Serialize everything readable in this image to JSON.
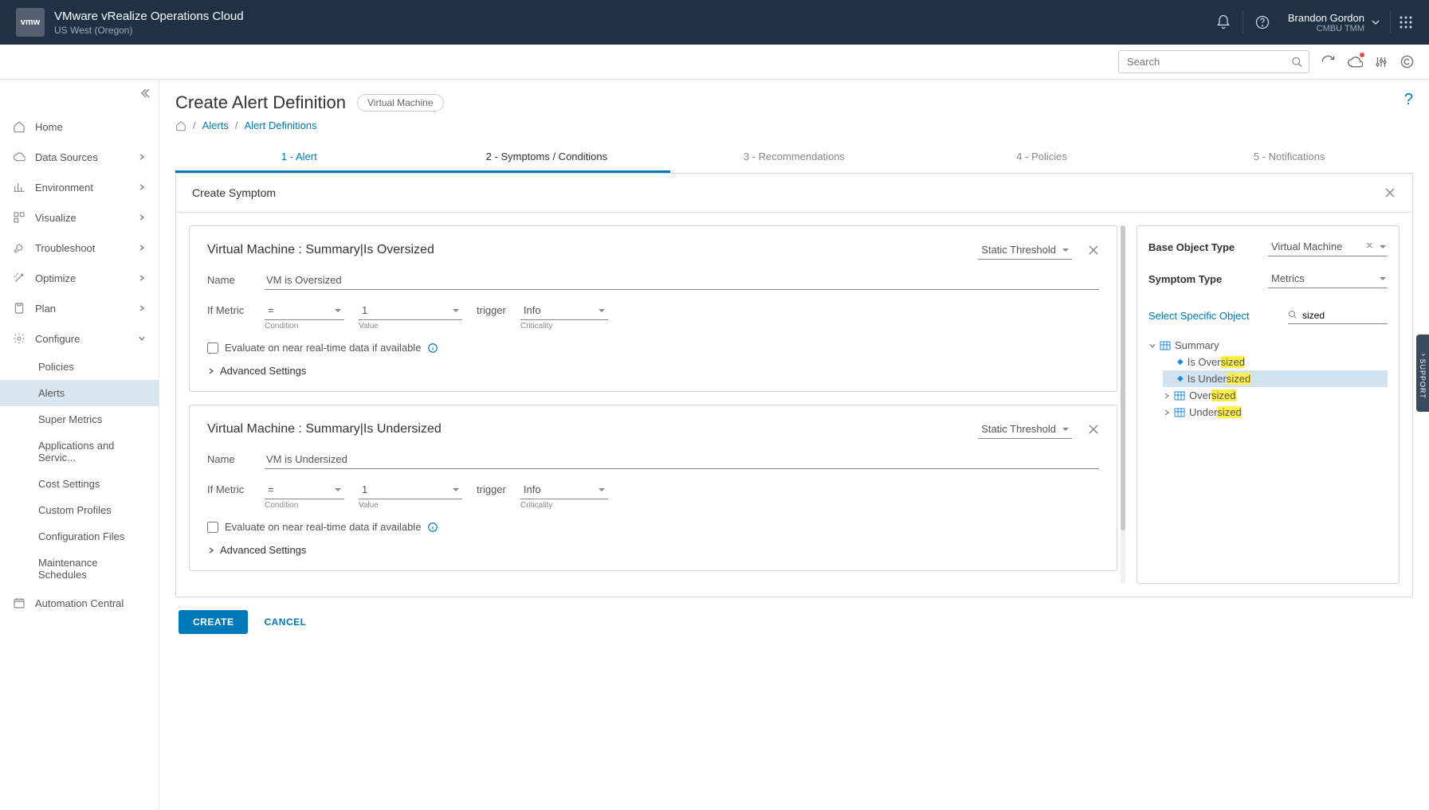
{
  "header": {
    "logo": "vmw",
    "app_title": "VMware vRealize Operations Cloud",
    "region": "US West (Oregon)",
    "user_name": "Brandon Gordon",
    "user_role": "CMBU TMM"
  },
  "utilbar": {
    "search_placeholder": "Search"
  },
  "sidebar": {
    "items": [
      {
        "icon": "home",
        "label": "Home"
      },
      {
        "icon": "cloud",
        "label": "Data Sources",
        "chev": true
      },
      {
        "icon": "bar",
        "label": "Environment",
        "chev": true
      },
      {
        "icon": "dash",
        "label": "Visualize",
        "chev": true
      },
      {
        "icon": "wrench",
        "label": "Troubleshoot",
        "chev": true
      },
      {
        "icon": "magic",
        "label": "Optimize",
        "chev": true
      },
      {
        "icon": "clip",
        "label": "Plan",
        "chev": true
      },
      {
        "icon": "gear",
        "label": "Configure",
        "chev": true,
        "expanded": true
      },
      {
        "icon": "cal",
        "label": "Automation Central"
      }
    ],
    "configure_sub": [
      {
        "label": "Policies"
      },
      {
        "label": "Alerts",
        "active": true
      },
      {
        "label": "Super Metrics"
      },
      {
        "label": "Applications and Servic..."
      },
      {
        "label": "Cost Settings"
      },
      {
        "label": "Custom Profiles"
      },
      {
        "label": "Configuration Files"
      },
      {
        "label": "Maintenance Schedules"
      }
    ]
  },
  "page": {
    "title": "Create Alert Definition",
    "chip": "Virtual Machine",
    "breadcrumb": {
      "alerts": "Alerts",
      "defs": "Alert Definitions"
    },
    "steps": [
      "1 - Alert",
      "2 - Symptoms / Conditions",
      "3 - Recommendations",
      "4 - Policies",
      "5 - Notifications"
    ],
    "panel_title": "Create Symptom",
    "symptoms": [
      {
        "title": "Virtual Machine : Summary|Is Oversized",
        "threshold": "Static Threshold",
        "name_label": "Name",
        "name_value": "VM is Oversized",
        "metric_label": "If Metric",
        "condition": "=",
        "cond_hint": "Condition",
        "value": "1",
        "value_hint": "Value",
        "trigger_label": "trigger",
        "trigger": "Info",
        "trigger_hint": "Criticality",
        "eval_label": "Evaluate on near real-time data if available",
        "advanced": "Advanced Settings"
      },
      {
        "title": "Virtual Machine : Summary|Is Undersized",
        "threshold": "Static Threshold",
        "name_label": "Name",
        "name_value": "VM is Undersized",
        "metric_label": "If Metric",
        "condition": "=",
        "cond_hint": "Condition",
        "value": "1",
        "value_hint": "Value",
        "trigger_label": "trigger",
        "trigger": "Info",
        "trigger_hint": "Criticality",
        "eval_label": "Evaluate on near real-time data if available",
        "advanced": "Advanced Settings"
      }
    ],
    "side": {
      "base_label": "Base Object Type",
      "base_value": "Virtual Machine",
      "type_label": "Symptom Type",
      "type_value": "Metrics",
      "select_link": "Select Specific Object",
      "search_value": "sized",
      "tree": {
        "root": "Summary",
        "leaves": [
          {
            "pre": "Is Over",
            "hl": "sized",
            "selected": false
          },
          {
            "pre": "Is Under",
            "hl": "sized",
            "selected": true
          }
        ],
        "folders": [
          {
            "pre": "Over",
            "hl": "sized"
          },
          {
            "pre": "Under",
            "hl": "sized"
          }
        ]
      }
    },
    "footer": {
      "create": "CREATE",
      "cancel": "CANCEL"
    }
  },
  "support": "SUPPORT"
}
